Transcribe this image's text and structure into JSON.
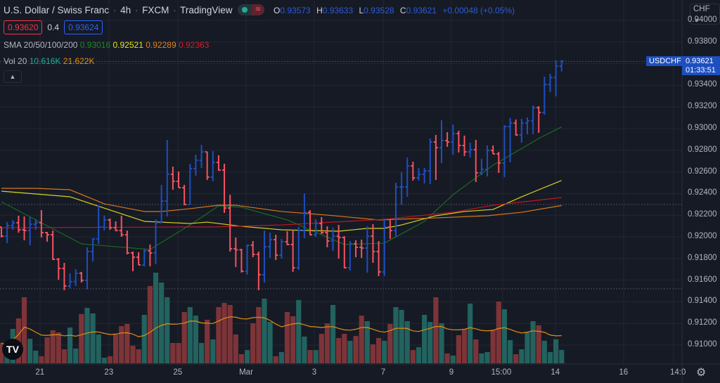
{
  "header": {
    "title": "U.S. Dollar / Swiss Franc",
    "interval": "4h",
    "exchange": "FXCM",
    "source": "TradingView",
    "separator": "·",
    "market_status_icon": "market-open-dot-icon",
    "ohlc": {
      "o_label": "O",
      "o": "0.93573",
      "h_label": "H",
      "h": "0.93633",
      "l_label": "L",
      "l": "0.93528",
      "c_label": "C",
      "c": "0.93621",
      "change": "+0.00048 (+0.05%)"
    }
  },
  "trade": {
    "sell_price": "0.93620",
    "spread": "0.4",
    "buy_price": "0.93624"
  },
  "sma_legend": {
    "label": "SMA 20/50/100/200",
    "v20": "0.93016",
    "v50": "0.92521",
    "v100": "0.92289",
    "v200": "0.92363"
  },
  "vol_legend": {
    "label": "Vol 20",
    "volume": "10.616K",
    "ma": "21.622K"
  },
  "price_axis": {
    "currency_button": "CHF ⌄",
    "ticks": [
      "0.94000",
      "0.93800",
      "0.93400",
      "0.93200",
      "0.93000",
      "0.92800",
      "0.92600",
      "0.92400",
      "0.92200",
      "0.92000",
      "0.91800",
      "0.91600",
      "0.91400",
      "0.91200",
      "0.91000"
    ],
    "symbol": "USDCHF",
    "last_price": "0.93621",
    "countdown": "01:33:51"
  },
  "time_axis": {
    "labels": [
      "21",
      "23",
      "25",
      "Mar",
      "3",
      "7",
      "9",
      "15:00",
      "14",
      "16",
      "14:0"
    ]
  },
  "colors": {
    "background": "#161a25",
    "up": "#1d4fbf",
    "down": "#f7525f",
    "vol_up": "#22625f",
    "vol_down": "#7d3438",
    "sma20": "#1b6b1f",
    "sma50": "#d4d41e",
    "sma100": "#d9781c",
    "sma200": "#c2161f",
    "vol_ma": "#e08f0e",
    "grid": "#232733"
  },
  "chart_data": {
    "type": "ohlc-bar",
    "symbol": "USDCHF",
    "ylim": [
      0.908,
      0.942
    ],
    "high": [
      0.92091,
      0.92136,
      0.92156,
      0.92195,
      0.92188,
      0.92182,
      0.92162,
      0.92247,
      0.92045,
      0.92058,
      0.91805,
      0.9176,
      0.91663,
      0.91701,
      0.91676,
      0.91903,
      0.91987,
      0.92286,
      0.92195,
      0.92169,
      0.92143,
      0.92195,
      0.92058,
      0.91864,
      0.91857,
      0.9189,
      0.91929,
      0.92162,
      0.9248,
      0.92896,
      0.92649,
      0.92604,
      0.9248,
      0.92675,
      0.92759,
      0.9285,
      0.92785,
      0.92792,
      0.92753,
      0.92675,
      0.92389,
      0.91994,
      0.9189,
      0.91929,
      0.91961,
      0.91864,
      0.92058,
      0.92039,
      0.92019,
      0.91981,
      0.92052,
      0.92065,
      0.92091,
      0.92402,
      0.92247,
      0.92162,
      0.92182,
      0.92097,
      0.92084,
      0.9211,
      0.92006,
      0.91961,
      0.91968,
      0.91974,
      0.92097,
      0.92117,
      0.91961,
      0.92169,
      0.92156,
      0.925,
      0.92597,
      0.92733,
      0.92694,
      0.92636,
      0.92636,
      0.92909,
      0.92941,
      0.93077,
      0.92967,
      0.93038,
      0.9298,
      0.92935,
      0.9287,
      0.92896,
      0.9272,
      0.92844,
      0.92844,
      0.92785,
      0.93032,
      0.93097,
      0.93084,
      0.9309,
      0.93103,
      0.93214,
      0.93207,
      0.9348,
      0.93506,
      0.9363,
      0.93633
    ],
    "low": [
      0.91994,
      0.91942,
      0.92065,
      0.92039,
      0.91968,
      0.91922,
      0.92065,
      0.91994,
      0.91955,
      0.91786,
      0.91604,
      0.91507,
      0.91526,
      0.91546,
      0.91578,
      0.91513,
      0.91773,
      0.91935,
      0.92058,
      0.92065,
      0.92052,
      0.92,
      0.91838,
      0.91682,
      0.9174,
      0.91727,
      0.91727,
      0.91747,
      0.9213,
      0.92188,
      0.92435,
      0.92454,
      0.92292,
      0.92299,
      0.92565,
      0.92636,
      0.92526,
      0.92513,
      0.9261,
      0.92221,
      0.91864,
      0.91721,
      0.91669,
      0.9165,
      0.91812,
      0.91507,
      0.91578,
      0.91805,
      0.91786,
      0.91799,
      0.91922,
      0.91676,
      0.91695,
      0.91987,
      0.92013,
      0.92,
      0.92026,
      0.91903,
      0.9187,
      0.91799,
      0.91708,
      0.91688,
      0.91812,
      0.91805,
      0.91669,
      0.9176,
      0.91637,
      0.91637,
      0.91981,
      0.91994,
      0.92299,
      0.9237,
      0.92519,
      0.92519,
      0.92493,
      0.92487,
      0.92526,
      0.92681,
      0.92831,
      0.92759,
      0.92779,
      0.92746,
      0.92733,
      0.92506,
      0.92571,
      0.92558,
      0.92766,
      0.92591,
      0.92552,
      0.92688,
      0.92935,
      0.9287,
      0.92948,
      0.92948,
      0.92961,
      0.93129,
      0.93337,
      0.93298,
      0.93528
    ],
    "close": [
      0.92006,
      0.92104,
      0.9213,
      0.92065,
      0.92058,
      0.92117,
      0.9213,
      0.92039,
      0.92019,
      0.91792,
      0.91708,
      0.91546,
      0.91585,
      0.91663,
      0.91598,
      0.91864,
      0.91981,
      0.92091,
      0.92156,
      0.92084,
      0.92058,
      0.92019,
      0.91851,
      0.91812,
      0.9174,
      0.9187,
      0.91851,
      0.9213,
      0.92331,
      0.92578,
      0.92513,
      0.92454,
      0.92299,
      0.9263,
      0.92707,
      0.92785,
      0.92552,
      0.92688,
      0.92617,
      0.92266,
      0.9189,
      0.9188,
      0.91682,
      0.91922,
      0.91838,
      0.9165,
      0.91909,
      0.91974,
      0.91831,
      0.91955,
      0.91929,
      0.91714,
      0.92058,
      0.92227,
      0.92019,
      0.92123,
      0.92039,
      0.91961,
      0.92006,
      0.91994,
      0.91714,
      0.91935,
      0.91903,
      0.91896,
      0.92006,
      0.91864,
      0.91676,
      0.92091,
      0.92058,
      0.92461,
      0.92461,
      0.92655,
      0.92545,
      0.92578,
      0.9261,
      0.92876,
      0.92824,
      0.92889,
      0.92876,
      0.92954,
      0.92844,
      0.92785,
      0.92805,
      0.92591,
      0.92623,
      0.92798,
      0.92766,
      0.92681,
      0.93019,
      0.93051,
      0.92941,
      0.93051,
      0.93071,
      0.93194,
      0.93149,
      0.93408,
      0.93473,
      0.93577,
      0.93621
    ],
    "volume_k": [
      16.1,
      12.0,
      27.2,
      35.5,
      52.2,
      19.4,
      10.0,
      5.6,
      20.5,
      26.1,
      24.4,
      11.1,
      28.3,
      11.7,
      38.9,
      43.8,
      39.4,
      22.8,
      4.4,
      5.6,
      22.8,
      29.4,
      31.1,
      13.9,
      11.1,
      38.3,
      61.0,
      71.6,
      63.8,
      52.2,
      16.1,
      16.1,
      40.5,
      44.4,
      37.7,
      16.1,
      34.4,
      18.9,
      44.4,
      47.7,
      46.1,
      22.8,
      7.2,
      10.5,
      31.6,
      44.4,
      51.1,
      32.7,
      5.6,
      8.9,
      40.5,
      37.2,
      50.0,
      21.1,
      10.5,
      10.5,
      23.3,
      31.6,
      46.1,
      20.0,
      23.3,
      17.8,
      21.6,
      37.7,
      33.3,
      15.0,
      20.0,
      17.8,
      31.1,
      44.4,
      42.2,
      33.3,
      10.5,
      12.8,
      38.3,
      32.7,
      52.2,
      31.6,
      7.8,
      6.1,
      22.2,
      27.2,
      47.2,
      18.9,
      7.8,
      8.9,
      26.6,
      48.8,
      42.7,
      18.3,
      7.2,
      11.1,
      24.4,
      33.3,
      30.0,
      17.8,
      8.9,
      19.0,
      10.616
    ],
    "volume_ma_period": 20,
    "sma": [
      {
        "name": "SMA 20",
        "color": "#1b6b1f",
        "points": [
          [
            0,
            0.92324
          ],
          [
            14,
            0.91935
          ],
          [
            26,
            0.91883
          ],
          [
            33,
            0.9211
          ],
          [
            38,
            0.92286
          ],
          [
            42,
            0.92273
          ],
          [
            50,
            0.92156
          ],
          [
            60,
            0.91929
          ],
          [
            67,
            0.91942
          ],
          [
            74,
            0.92143
          ],
          [
            79,
            0.92389
          ],
          [
            86,
            0.92662
          ],
          [
            94,
            0.92909
          ],
          [
            98,
            0.93016
          ]
        ]
      },
      {
        "name": "SMA 50",
        "color": "#d4d41e",
        "points": [
          [
            0,
            0.92422
          ],
          [
            12,
            0.9237
          ],
          [
            25,
            0.92143
          ],
          [
            33,
            0.92123
          ],
          [
            36,
            0.92136
          ],
          [
            42,
            0.92097
          ],
          [
            49,
            0.92065
          ],
          [
            59,
            0.92052
          ],
          [
            64,
            0.92078
          ],
          [
            67,
            0.92078
          ],
          [
            70,
            0.9211
          ],
          [
            76,
            0.92195
          ],
          [
            81,
            0.92234
          ],
          [
            86,
            0.92253
          ],
          [
            91,
            0.9237
          ],
          [
            98,
            0.92521
          ]
        ]
      },
      {
        "name": "SMA 100",
        "color": "#d9781c",
        "points": [
          [
            0,
            0.92448
          ],
          [
            6,
            0.92448
          ],
          [
            12,
            0.92435
          ],
          [
            18,
            0.92305
          ],
          [
            25,
            0.92234
          ],
          [
            28,
            0.92234
          ],
          [
            33,
            0.9226
          ],
          [
            38,
            0.92292
          ],
          [
            41,
            0.92292
          ],
          [
            49,
            0.92234
          ],
          [
            57,
            0.92201
          ],
          [
            66,
            0.92156
          ],
          [
            76,
            0.92175
          ],
          [
            85,
            0.92195
          ],
          [
            91,
            0.92227
          ],
          [
            98,
            0.92289
          ]
        ]
      },
      {
        "name": "SMA 200",
        "color": "#c2161f",
        "points": [
          [
            0,
            0.92084
          ],
          [
            33,
            0.92091
          ],
          [
            37,
            0.92091
          ],
          [
            49,
            0.9211
          ],
          [
            67,
            0.92162
          ],
          [
            79,
            0.92227
          ],
          [
            86,
            0.92292
          ],
          [
            98,
            0.92363
          ]
        ]
      }
    ],
    "reference_lines": [
      0.93621,
      0.92299,
      0.9152
    ]
  }
}
